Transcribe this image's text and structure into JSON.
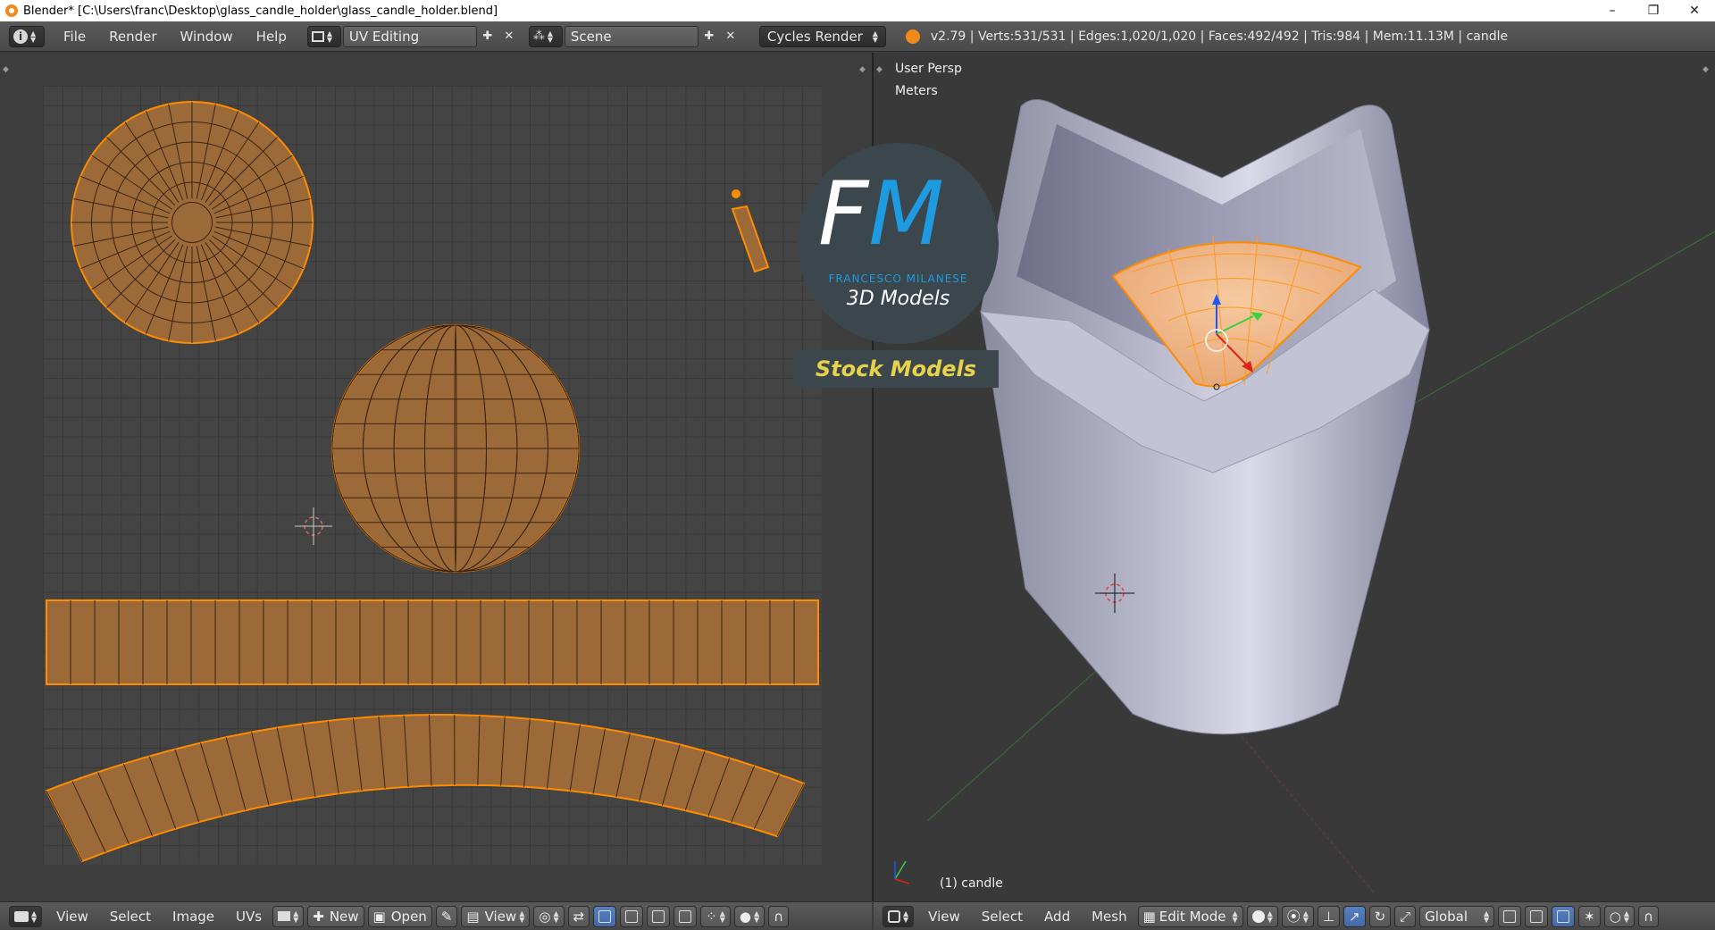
{
  "window": {
    "title": "Blender* [C:\\Users\\franc\\Desktop\\glass_candle_holder\\glass_candle_holder.blend]",
    "controls": [
      "–",
      "❐",
      "✕"
    ]
  },
  "header": {
    "menus": [
      "File",
      "Render",
      "Window",
      "Help"
    ],
    "screen_layout": "UV Editing",
    "scene": "Scene",
    "render_engine": "Cycles Render",
    "stats": "v2.79 | Verts:531/531 | Edges:1,020/1,020 | Faces:492/492 | Tris:984 | Mem:11.13M | candle"
  },
  "uv_editor": {
    "footer_menus": [
      "View",
      "Select",
      "Image",
      "UVs"
    ],
    "new_label": "New",
    "open_label": "Open",
    "view_label": "View"
  },
  "view3d": {
    "perspective": "User Persp",
    "units": "Meters",
    "object_label": "(1) candle",
    "footer_menus": [
      "View",
      "Select",
      "Add",
      "Mesh"
    ],
    "mode": "Edit Mode",
    "orientation": "Global"
  },
  "watermark": {
    "logo_letters_1": "F",
    "logo_letters_2": "M",
    "brand": "FRANCESCO MILANESE",
    "subtitle": "3D Models",
    "badge": "Stock Models"
  },
  "colors": {
    "uv_island_fill": "#9c6a38",
    "uv_edge": "#ff8c00",
    "mesh_body": "#c9c9dc",
    "header_bg": "#505050",
    "accent_blue": "#1e9be0",
    "badge_yellow": "#e8d24a"
  }
}
